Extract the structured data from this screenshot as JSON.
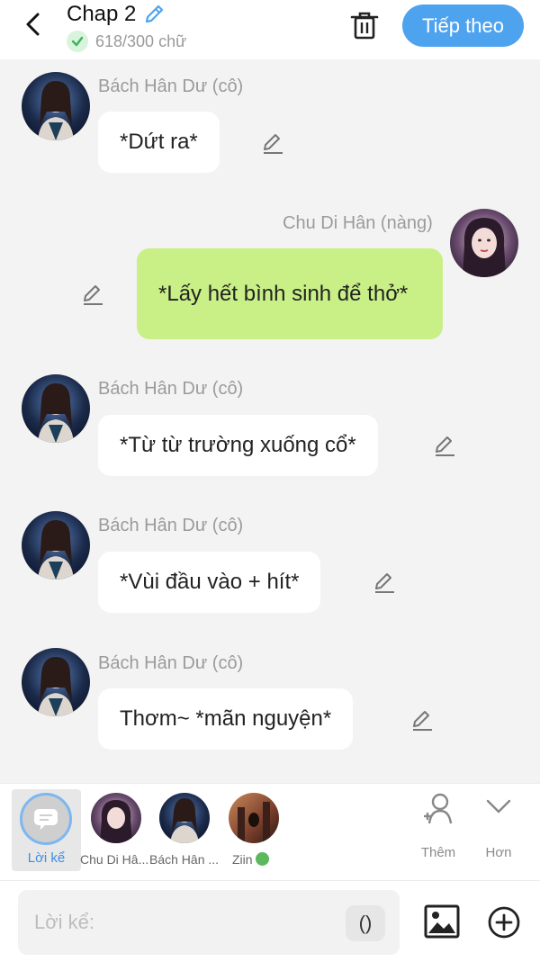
{
  "header": {
    "title": "Chap 2",
    "word_count": "618/300 chữ",
    "next_label": "Tiếp theo"
  },
  "messages": [
    {
      "speaker": "Bách Hân Dư (cô)",
      "text": "*Dứt ra*",
      "side": "left"
    },
    {
      "speaker": "Chu Di Hân (nàng)",
      "text": "*Lấy hết bình sinh để thở*",
      "side": "right"
    },
    {
      "speaker": "Bách Hân Dư (cô)",
      "text": "*Từ từ trường xuống cổ*",
      "side": "left"
    },
    {
      "speaker": "Bách Hân Dư (cô)",
      "text": "*Vùi đầu vào + hít*",
      "side": "left"
    },
    {
      "speaker": "Bách Hân Dư (cô)",
      "text": "Thơm~ *mãn nguyện*",
      "side": "left"
    }
  ],
  "characters": {
    "narrator": "Lời kể",
    "items": [
      {
        "label": "Chu Di Hâ..."
      },
      {
        "label": "Bách Hân ..."
      },
      {
        "label": "Ziin"
      }
    ],
    "add_label": "Thêm",
    "more_label": "Hơn"
  },
  "composer": {
    "placeholder": "Lời kể:",
    "paren_label": "()"
  },
  "colors": {
    "accent": "#4ea3ef",
    "my_bubble": "#c9ef87",
    "other_bubble": "#ffffff",
    "background": "#f3f3f3"
  }
}
